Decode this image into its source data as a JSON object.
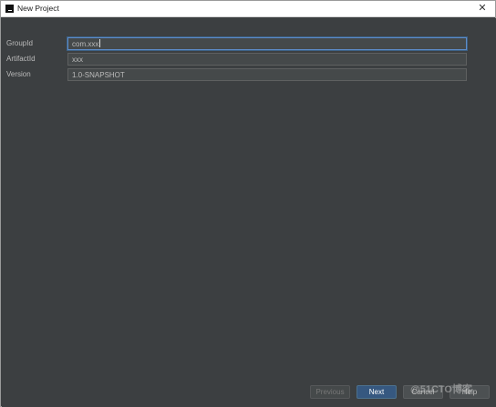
{
  "window": {
    "title": "New Project",
    "close_glyph": "✕"
  },
  "form": {
    "fields": [
      {
        "label": "GroupId",
        "value": "com.xxx",
        "focused": true
      },
      {
        "label": "ArtifactId",
        "value": "xxx",
        "focused": false
      },
      {
        "label": "Version",
        "value": "1.0-SNAPSHOT",
        "focused": false
      }
    ]
  },
  "footer": {
    "previous_label": "Previous",
    "next_label": "Next",
    "cancel_label": "Cancel",
    "help_label": "Help"
  },
  "watermark": {
    "text": "@51CTO博客"
  },
  "icons": {
    "app": "intellij-app-icon",
    "close": "close-icon"
  }
}
